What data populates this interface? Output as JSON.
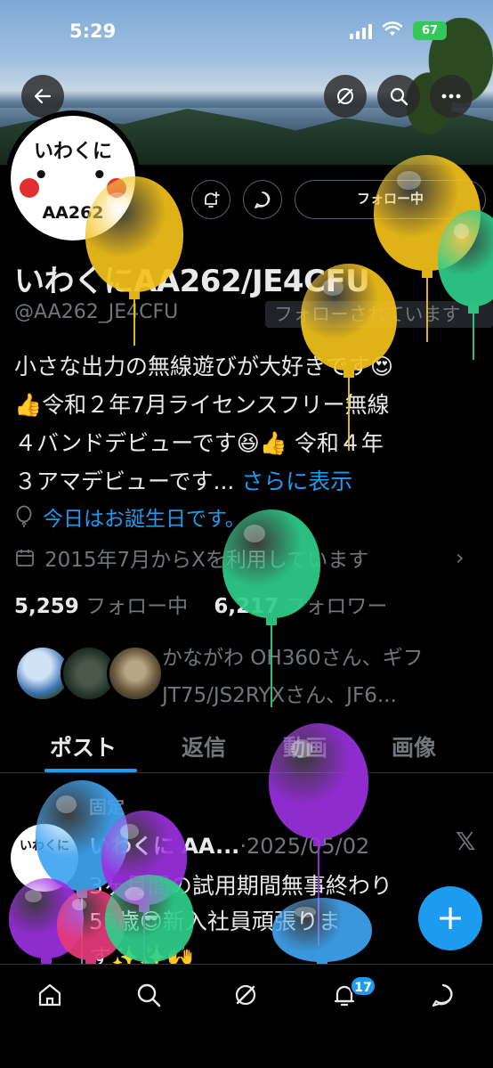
{
  "status_bar": {
    "time": "5:29",
    "battery": "67"
  },
  "profile": {
    "avatar_top": "いわくに",
    "avatar_face": "• •",
    "avatar_bottom": "AA262",
    "display_name": "いわくにAA262/JE4CFU",
    "handle": "@AA262_JE4CFU",
    "follows_you": "フォローされています",
    "follow_button": "フォロー中",
    "bio_lines": [
      "小さな出力の無線遊びが大好きです😍",
      "👍令和２年7月ライセンスフリー無線",
      "４バンドデビューです😆👍 令和４年",
      "３アマデビューです..."
    ],
    "show_more": "さらに表示",
    "birthday": "今日はお誕生日です。",
    "joined": "2015年7月からXを利用しています",
    "following_count": "5,259",
    "following_label": "フォロー中",
    "followers_count": "6,217",
    "followers_label": "フォロワー",
    "mutuals_line1": "かながわ OH360さん、ギフ",
    "mutuals_line2": "JT75/JS2RYXさん、JF6..."
  },
  "tabs": [
    "ポスト",
    "返信",
    "動画",
    "画像"
  ],
  "pinned_post": {
    "pinned_label": "固定",
    "author": "いわくに AA...",
    "date": "·2025/05/02",
    "avatar_text": "いわくに",
    "lines": [
      "3ヶ月間の試用期間無事終わり",
      "55歳😎新入社員頑張りま",
      "す✨✨🙌"
    ]
  },
  "notifications_badge": "17",
  "icons": {
    "back": "back-arrow-icon",
    "grok": "grok-icon",
    "search": "search-icon",
    "more": "more-icon",
    "notify_subscribe": "bell-plus-icon",
    "message": "message-icon",
    "birthday": "balloon-icon",
    "calendar": "calendar-icon",
    "home": "home-icon",
    "notifications": "bell-icon",
    "messages": "chat-icon",
    "compose": "plus-icon"
  },
  "colors": {
    "accent": "#1d9bf0",
    "balloon_yellow": "#f2c21b",
    "balloon_green": "#2ecf8a",
    "balloon_purple": "#9b30e0",
    "balloon_blue": "#3fa4f0",
    "balloon_pink": "#e83a7a"
  }
}
